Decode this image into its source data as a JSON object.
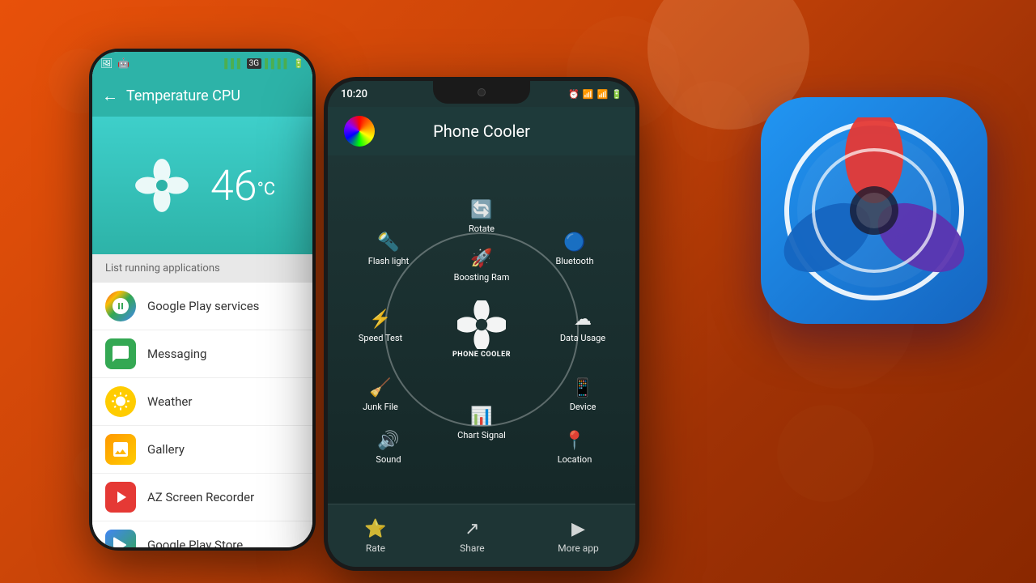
{
  "background": {
    "gradient": "orange-red"
  },
  "left_phone": {
    "status_bar": {
      "icons": [
        "photo",
        "android"
      ]
    },
    "top_bar": {
      "back_label": "←",
      "title": "Temperature CPU"
    },
    "temp_display": {
      "value": "46",
      "unit": "°C"
    },
    "running_apps_header": "List running applications",
    "apps": [
      {
        "name": "Google Play services",
        "icon_type": "gps"
      },
      {
        "name": "Messaging",
        "icon_type": "msg"
      },
      {
        "name": "Weather",
        "icon_type": "weather"
      },
      {
        "name": "Gallery",
        "icon_type": "gallery"
      },
      {
        "name": "AZ Screen Recorder",
        "icon_type": "az"
      },
      {
        "name": "Google Play Store",
        "icon_type": "play"
      }
    ]
  },
  "right_phone": {
    "status_bar": {
      "time": "10:20",
      "icons": [
        "alarm",
        "wifi",
        "signal",
        "battery"
      ]
    },
    "header": {
      "title": "Phone Cooler"
    },
    "menu_items": [
      {
        "label": "Flash light",
        "icon": "🔦",
        "position": "top-left"
      },
      {
        "label": "Rotate",
        "icon": "🔄",
        "position": "top-center"
      },
      {
        "label": "Bluetooth",
        "icon": "🔵",
        "position": "top-right"
      },
      {
        "label": "Speed Test",
        "icon": "⚡",
        "position": "mid-left"
      },
      {
        "label": "Boosting Ram",
        "icon": "🚀",
        "position": "mid-top"
      },
      {
        "label": "Data Usage",
        "icon": "☁",
        "position": "mid-right"
      },
      {
        "label": "Junk File",
        "icon": "🧹",
        "position": "low-left"
      },
      {
        "label": "Device",
        "icon": "📱",
        "position": "low-right"
      },
      {
        "label": "Sound",
        "icon": "🔊",
        "position": "bot-left"
      },
      {
        "label": "Location",
        "icon": "📍",
        "position": "bot-right"
      },
      {
        "label": "Chart Signal",
        "icon": "📊",
        "position": "bot-center"
      }
    ],
    "center_label": "PHONE COOLER",
    "bottom_nav": [
      {
        "label": "Rate",
        "icon": "⭐"
      },
      {
        "label": "Share",
        "icon": "↗"
      },
      {
        "label": "More app",
        "icon": "▶"
      }
    ]
  },
  "app_icon": {
    "alt": "Phone Cooler App Icon"
  }
}
